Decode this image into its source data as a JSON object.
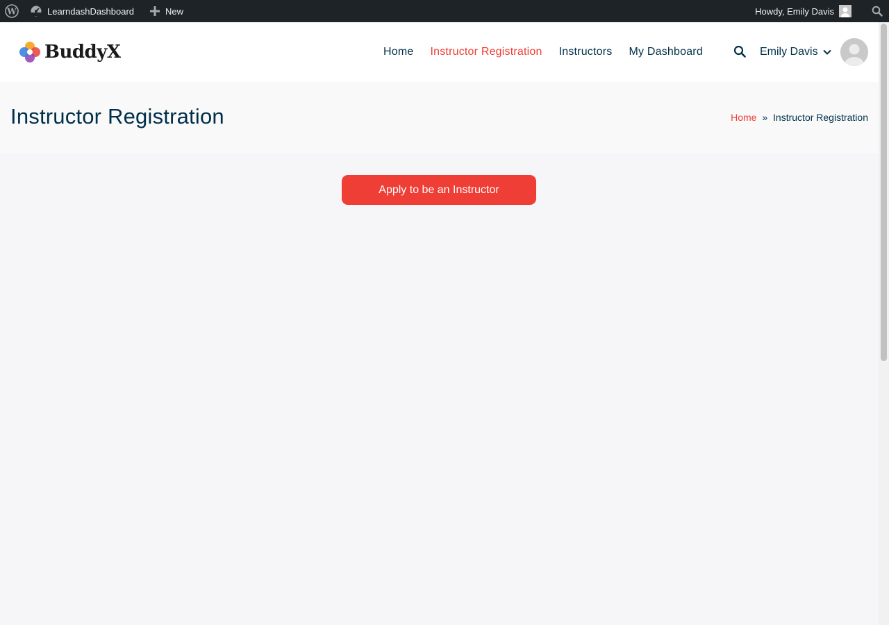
{
  "admin_bar": {
    "site_name": "LearndashDashboard",
    "new_label": "New",
    "howdy": "Howdy, Emily Davis"
  },
  "header": {
    "logo_text": "BuddyX",
    "nav": [
      {
        "label": "Home",
        "active": false
      },
      {
        "label": "Instructor Registration",
        "active": true
      },
      {
        "label": "Instructors",
        "active": false
      },
      {
        "label": "My Dashboard",
        "active": false
      }
    ],
    "user_name": "Emily Davis"
  },
  "page": {
    "title": "Instructor Registration",
    "breadcrumb_home": "Home",
    "breadcrumb_sep": "»",
    "breadcrumb_current": "Instructor Registration"
  },
  "content": {
    "apply_button": "Apply to be an Instructor"
  },
  "colors": {
    "accent": "#ef3e36",
    "text_dark": "#003049",
    "admin_bar": "#1d2327"
  }
}
